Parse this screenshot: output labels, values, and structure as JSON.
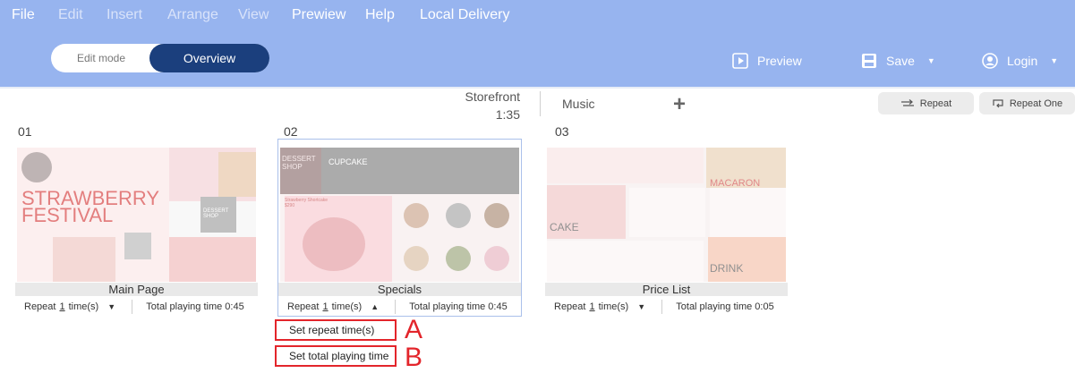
{
  "menu": [
    {
      "label": "File",
      "dim": false
    },
    {
      "label": "Edit",
      "dim": true
    },
    {
      "label": "Insert",
      "dim": true
    },
    {
      "label": "Arrange",
      "dim": true
    },
    {
      "label": "View",
      "dim": true
    },
    {
      "label": "Prewiew",
      "dim": false
    },
    {
      "label": "Help",
      "dim": false
    },
    {
      "label": "Local Delivery",
      "dim": false
    }
  ],
  "mode_toggle": {
    "edit_label": "Edit mode",
    "overview_label": "Overview"
  },
  "actions": {
    "preview": "Preview",
    "save": "Save",
    "login": "Login"
  },
  "storefront": {
    "name": "Storefront",
    "duration": "1:35"
  },
  "music": {
    "label": "Music"
  },
  "repeat_buttons": {
    "repeat": "Repeat",
    "repeat_one": "Repeat One"
  },
  "pages": [
    {
      "num": "01",
      "title": "Main Page",
      "repeat_prefix": "Repeat",
      "repeat_count": "1",
      "repeat_unit": "time(s)",
      "total": "Total playing time 0:45",
      "thumb": {
        "headline1": "STRAWBERRY",
        "headline2": "FESTIVAL",
        "badge": "DESSERT SHOP"
      }
    },
    {
      "num": "02",
      "title": "Specials",
      "repeat_prefix": "Repeat",
      "repeat_count": "1",
      "repeat_unit": "time(s)",
      "total": "Total playing time 0:45",
      "thumb": {
        "badge": "DESSERT SHOP",
        "heading": "CUPCAKE",
        "sub": "Strawberry Shortcake $290"
      }
    },
    {
      "num": "03",
      "title": "Price List",
      "repeat_prefix": "Repeat",
      "repeat_count": "1",
      "repeat_unit": "time(s)",
      "total": "Total playing time 0:05",
      "thumb": {
        "cake": "CAKE",
        "macaron": "MACARON",
        "drink": "DRINK"
      }
    }
  ],
  "popup": {
    "set_repeat": "Set repeat time(s)",
    "set_total": "Set total playing time"
  },
  "annotations": {
    "a": "A",
    "b": "B"
  },
  "colors": {
    "topbar": "#97b4ef",
    "toggle_active": "#1b3f7d",
    "annotation_red": "#e3252b"
  }
}
